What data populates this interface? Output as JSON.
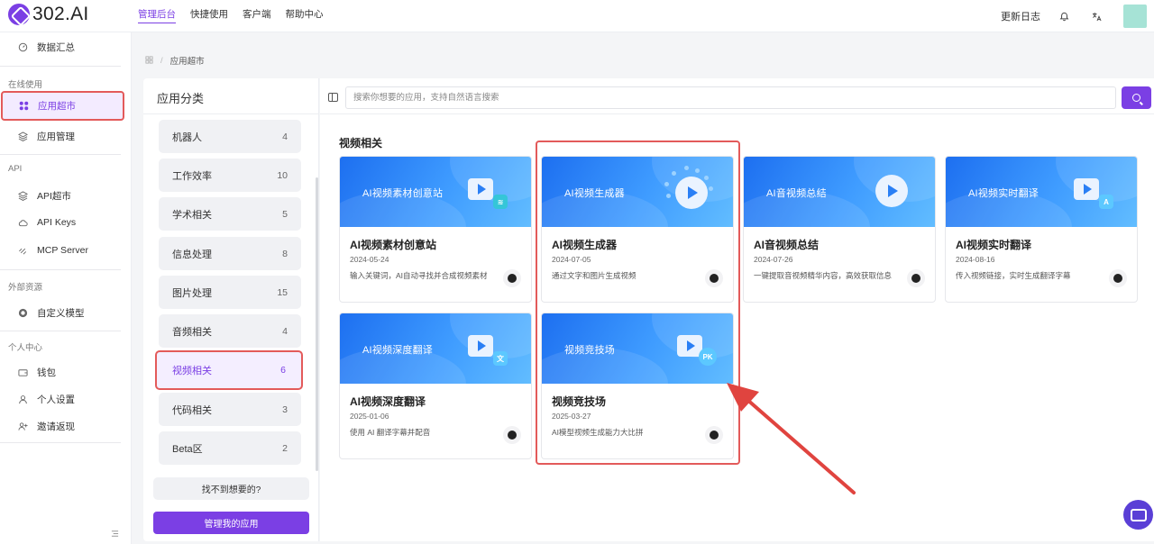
{
  "app": {
    "logo_text": "302.AI"
  },
  "topnav": [
    {
      "label": "管理后台",
      "active": true
    },
    {
      "label": "快捷使用",
      "active": false
    },
    {
      "label": "客户端",
      "active": false
    },
    {
      "label": "帮助中心",
      "active": false
    }
  ],
  "topright": {
    "changelog": "更新日志",
    "bell_icon": "bell-icon",
    "translate_icon": "translate-icon"
  },
  "sidebar": {
    "dashboard": "数据汇总",
    "group_online": "在线使用",
    "app_market": "应用超市",
    "app_manage": "应用管理",
    "group_api": "API",
    "api_market": "API超市",
    "api_keys": "API Keys",
    "mcp_server": "MCP Server",
    "group_external": "外部资源",
    "custom_model": "自定义模型",
    "group_personal": "个人中心",
    "wallet": "钱包",
    "personal_settings": "个人设置",
    "invite_rebate": "邀请返现",
    "collapse_icon": "collapse-icon"
  },
  "breadcrumb": {
    "current": "应用超市"
  },
  "categories": {
    "title": "应用分类",
    "items": [
      {
        "label": "机器人",
        "count": "4"
      },
      {
        "label": "工作效率",
        "count": "10"
      },
      {
        "label": "学术相关",
        "count": "5"
      },
      {
        "label": "信息处理",
        "count": "8"
      },
      {
        "label": "图片处理",
        "count": "15"
      },
      {
        "label": "音频相关",
        "count": "4"
      },
      {
        "label": "视频相关",
        "count": "6",
        "active": true
      },
      {
        "label": "代码相关",
        "count": "3"
      },
      {
        "label": "Beta区",
        "count": "2"
      }
    ],
    "not_found": "找不到想要的?",
    "manage": "管理我的应用"
  },
  "search": {
    "placeholder": "搜索你想要的应用，支持自然语言搜索"
  },
  "section": {
    "title": "视频相关"
  },
  "cards": [
    {
      "banner": "AI视频素材创意站",
      "name": "AI视频素材创意站",
      "date": "2024-05-24",
      "desc": "输入关键词，AI自动寻找并合成视频素材"
    },
    {
      "banner": "AI视频生成器",
      "name": "AI视频生成器",
      "date": "2024-07-05",
      "desc": "通过文字和图片生成视频"
    },
    {
      "banner": "AI音视频总结",
      "name": "AI音视频总结",
      "date": "2024-07-26",
      "desc": "一键提取音视频精华内容，高效获取信息"
    },
    {
      "banner": "AI视频实时翻译",
      "name": "AI视频实时翻译",
      "date": "2024-08-16",
      "desc": "传入视频链接，实时生成翻译字幕"
    },
    {
      "banner": "AI视频深度翻译",
      "name": "AI视频深度翻译",
      "date": "2025-01-06",
      "desc": "使用 AI 翻译字幕并配音"
    },
    {
      "banner": "视频竞技场",
      "name": "视频竞技场",
      "date": "2025-03-27",
      "desc": "AI模型视频生成能力大比拼"
    }
  ],
  "colors": {
    "accent": "#7b3fe4",
    "highlight": "#e35a5a",
    "banner_blue": "#2a7ff5"
  }
}
